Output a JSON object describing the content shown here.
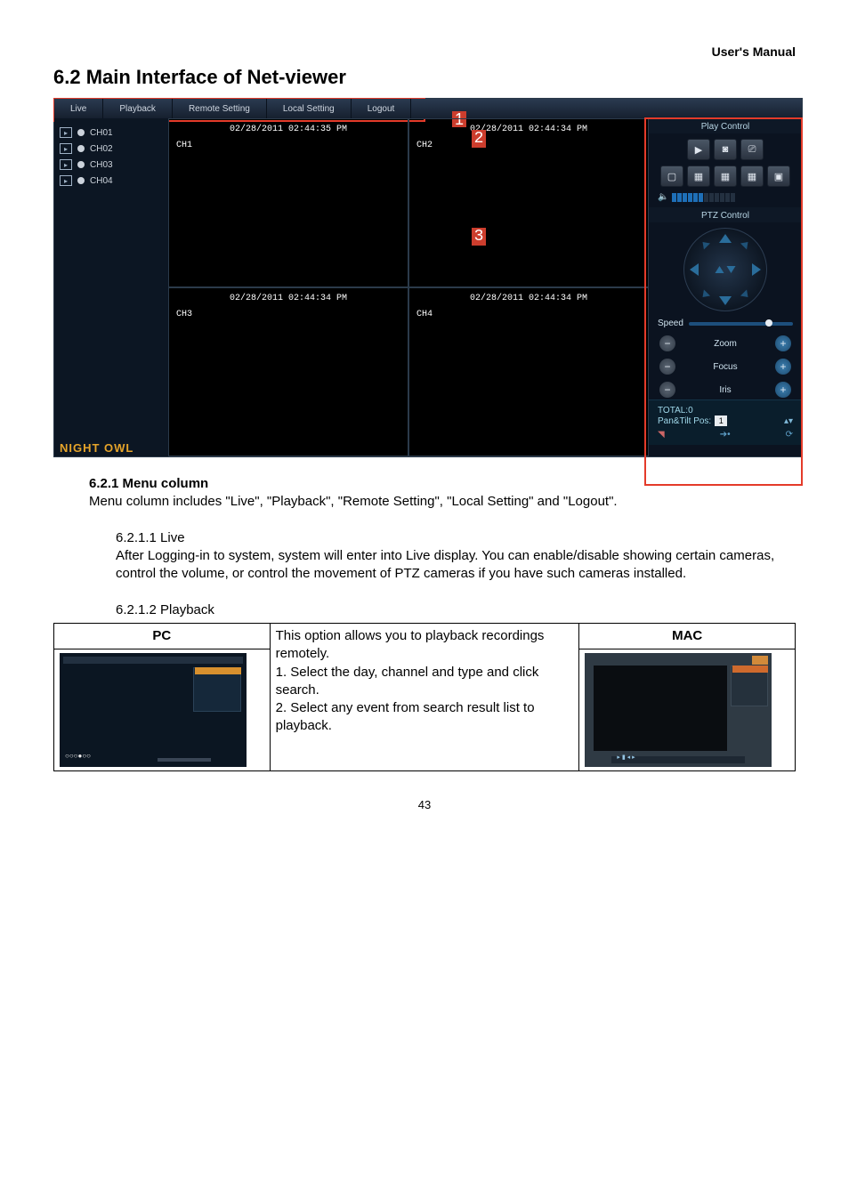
{
  "header": {
    "right": "User's Manual"
  },
  "section_title": "6.2 Main Interface of Net-viewer",
  "menu": {
    "live": "Live",
    "playback": "Playback",
    "remote": "Remote Setting",
    "local": "Local Setting",
    "logout": "Logout"
  },
  "channels": {
    "c1": "CH01",
    "c2": "CH02",
    "c3": "CH03",
    "c4": "CH04"
  },
  "video": {
    "p1": {
      "ts": "02/28/2011 02:44:35 PM",
      "ch": "CH1"
    },
    "p2": {
      "ts": "02/28/2011 02:44:34 PM",
      "ch": "CH2"
    },
    "p3": {
      "ts": "02/28/2011 02:44:34 PM",
      "ch": "CH3"
    },
    "p4": {
      "ts": "02/28/2011 02:44:34 PM",
      "ch": "CH4"
    }
  },
  "logo": "NIGHT OWL",
  "panels": {
    "play_title": "Play Control",
    "ptz_title": "PTZ Control",
    "speed": "Speed",
    "zoom": "Zoom",
    "focus": "Focus",
    "iris": "Iris",
    "total": "TOTAL:0",
    "pantilt": "Pan&Tilt Pos:",
    "pantilt_val": "1"
  },
  "callouts": {
    "c1": "1",
    "c2": "2",
    "c3": "3"
  },
  "doc": {
    "h621": "6.2.1 Menu column",
    "p621": "Menu column includes \"Live\", \"Playback\", \"Remote Setting\", \"Local Setting\" and \"Logout\".",
    "h6211": "6.2.1.1 Live",
    "p6211": "After Logging-in to system, system will enter into Live display. You can enable/disable showing certain cameras, control the volume, or control the movement of PTZ cameras if you have such cameras installed.",
    "h6212": "6.2.1.2 Playback",
    "table": {
      "pc": "PC",
      "mac": "MAC",
      "mid1": "This option allows you to playback recordings remotely.",
      "mid2": "1. Select the day, channel and type and click search.",
      "mid3": "2. Select any event from search result list to playback."
    }
  },
  "page_number": "43"
}
